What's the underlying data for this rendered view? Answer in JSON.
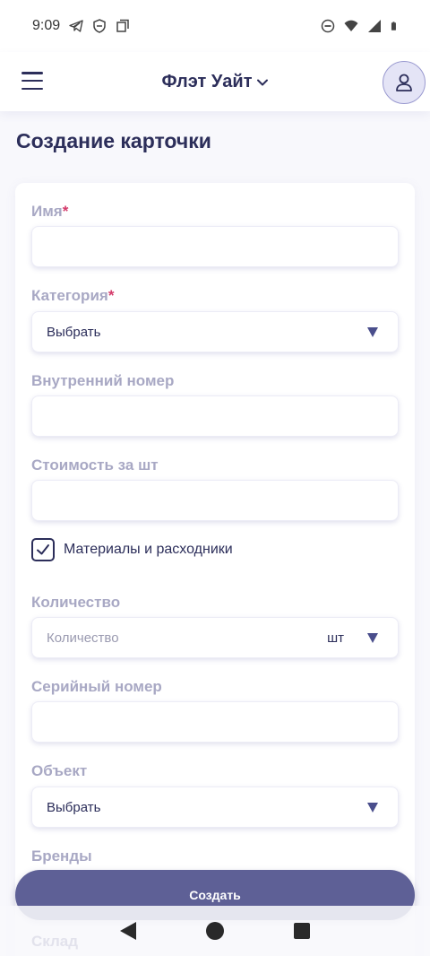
{
  "status_bar": {
    "time": "9:09",
    "left_icons": [
      "telegram-icon",
      "shield-icon",
      "copy-icon"
    ],
    "right_icons": [
      "dnd-icon",
      "wifi-icon",
      "signal-icon",
      "battery-icon"
    ]
  },
  "app_bar": {
    "title": "Флэт Уайт",
    "title_chevron": "chevron-down-icon",
    "menu_icon": "hamburger-menu-icon",
    "avatar_icon": "user-icon"
  },
  "page": {
    "title": "Создание карточки"
  },
  "form": {
    "name": {
      "label": "Имя",
      "required_mark": "*",
      "value": ""
    },
    "category": {
      "label": "Категория",
      "required_mark": "*",
      "value": "Выбрать"
    },
    "internal_number": {
      "label": "Внутренний номер",
      "value": ""
    },
    "cost": {
      "label": "Стоимость за шт",
      "value": ""
    },
    "materials": {
      "label": "Материалы и расходники",
      "checked": true
    },
    "quantity": {
      "label": "Количество",
      "placeholder": "Количество",
      "unit": "шт"
    },
    "serial": {
      "label": "Серийный номер",
      "value": ""
    },
    "object": {
      "label": "Объект",
      "value": "Выбрать"
    },
    "brands": {
      "label": "Бренды"
    },
    "warehouse": {
      "label": "Склад"
    }
  },
  "create_button": {
    "label": "Создать"
  },
  "colors": {
    "primary": "#5e6096",
    "title": "#2c2e5a",
    "label": "#a8a8c4",
    "required": "#d43a6a",
    "background": "#f8f8fc"
  }
}
